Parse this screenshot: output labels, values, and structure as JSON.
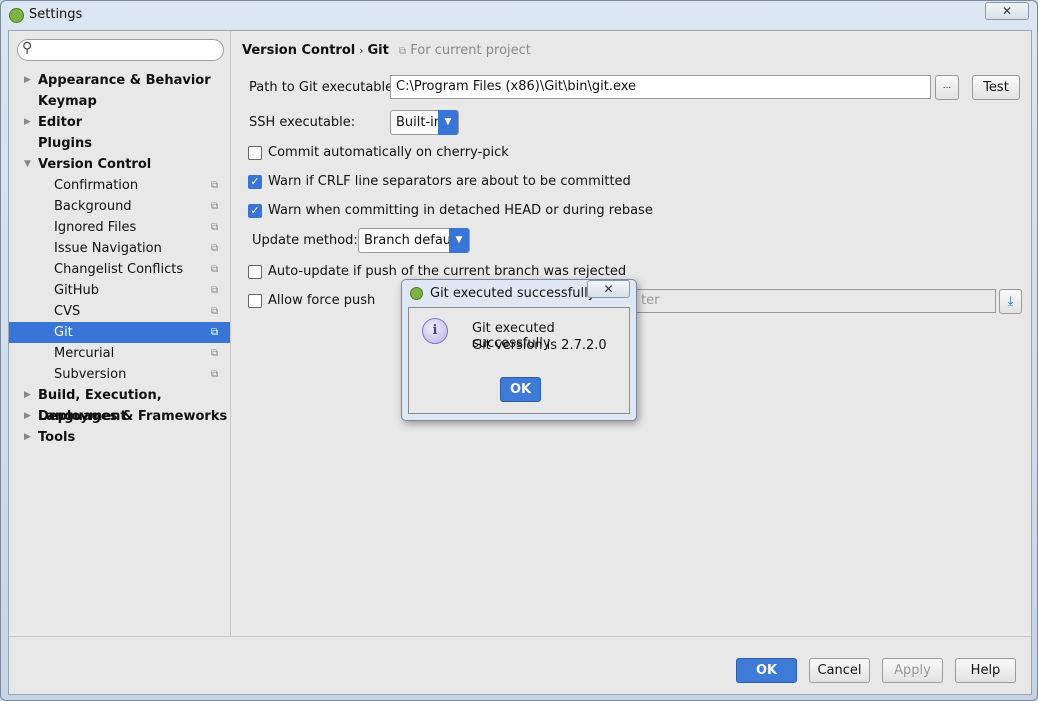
{
  "window": {
    "title": "Settings",
    "close": "✕"
  },
  "sidebar": {
    "search_placeholder": "",
    "items": [
      {
        "label": "Appearance & Behavior",
        "level": 0,
        "arrow": "▶"
      },
      {
        "label": "Keymap",
        "level": 0
      },
      {
        "label": "Editor",
        "level": 0,
        "arrow": "▶"
      },
      {
        "label": "Plugins",
        "level": 0
      },
      {
        "label": "Version Control",
        "level": 0,
        "arrow": "▼"
      },
      {
        "label": "Confirmation",
        "level": 1
      },
      {
        "label": "Background",
        "level": 1
      },
      {
        "label": "Ignored Files",
        "level": 1
      },
      {
        "label": "Issue Navigation",
        "level": 1
      },
      {
        "label": "Changelist Conflicts",
        "level": 1
      },
      {
        "label": "GitHub",
        "level": 1
      },
      {
        "label": "CVS",
        "level": 1
      },
      {
        "label": "Git",
        "level": 1,
        "selected": true
      },
      {
        "label": "Mercurial",
        "level": 1
      },
      {
        "label": "Subversion",
        "level": 1
      },
      {
        "label": "Build, Execution, Deployment",
        "level": 0,
        "arrow": "▶"
      },
      {
        "label": "Languages & Frameworks",
        "level": 0,
        "arrow": "▶"
      },
      {
        "label": "Tools",
        "level": 0,
        "arrow": "▶"
      }
    ]
  },
  "breadcrumb": {
    "parent": "Version Control",
    "sep": "›",
    "current": "Git",
    "scope": "For current project"
  },
  "git": {
    "path_label": "Path to Git executable:",
    "path_value": "C:\\Program Files (x86)\\Git\\bin\\git.exe",
    "browse": "...",
    "test": "Test",
    "ssh_label": "SSH executable:",
    "ssh_value": "Built-in",
    "cherry_pick": "Commit automatically on cherry-pick",
    "crlf": "Warn if CRLF line separators are about to be committed",
    "detached": "Warn when committing in detached HEAD or during rebase",
    "update_label": "Update method:",
    "update_value": "Branch default",
    "auto_update": "Auto-update if push of the current branch was rejected",
    "force_push": "Allow force push",
    "protected_fragment": "ter"
  },
  "dialog": {
    "title": "Git executed successfully",
    "close": "✕",
    "line1": "Git executed successfully",
    "line2": "Git version is 2.7.2.0",
    "ok": "OK",
    "icon": "i"
  },
  "footer": {
    "ok": "OK",
    "cancel": "Cancel",
    "apply": "Apply",
    "help": "Help"
  }
}
